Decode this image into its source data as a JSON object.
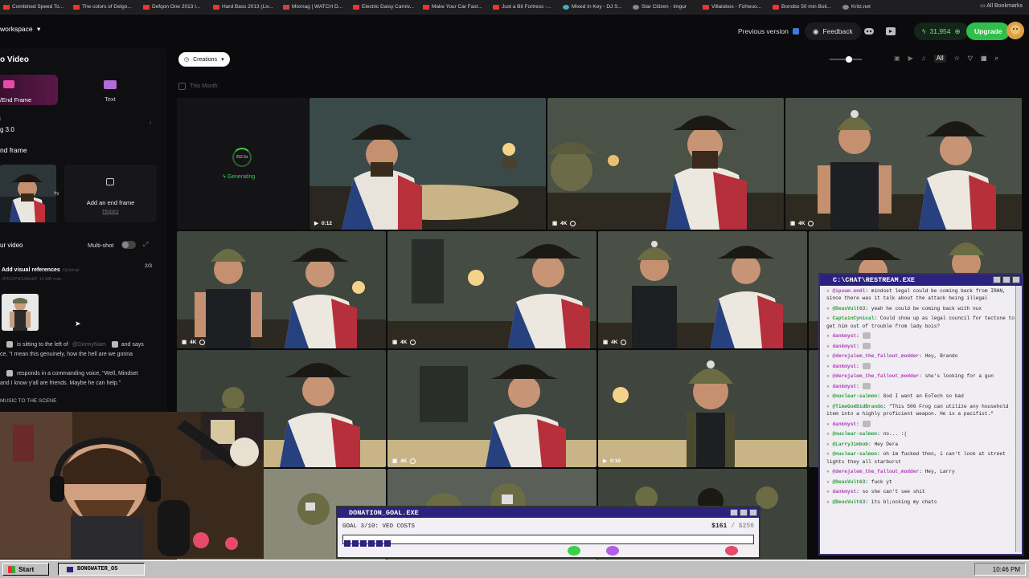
{
  "bookmarks": [
    {
      "label": "Combined Speed To...",
      "icon": "feather-icon"
    },
    {
      "label": "The colors of Delgo...",
      "icon": "youtube-icon"
    },
    {
      "label": "Defqon One 2013 I...",
      "icon": "youtube-icon"
    },
    {
      "label": "Hard Bass 2013 (Liv...",
      "icon": "youtube-icon"
    },
    {
      "label": "Mixmag | WATCH D...",
      "icon": "mixmag-icon"
    },
    {
      "label": "Electric Daisy Carniv...",
      "icon": "youtube-icon"
    },
    {
      "label": "Make Your Car Fast...",
      "icon": "youtube-icon"
    },
    {
      "label": "Just a Bit Fortress -...",
      "icon": "youtube-icon"
    },
    {
      "label": "Mixed In Key - DJ S...",
      "icon": "site-icon"
    },
    {
      "label": "Star Citizen - Imgur",
      "icon": "globe-icon"
    },
    {
      "label": "Villalobos - Fizheuo...",
      "icon": "youtube-icon"
    },
    {
      "label": "Bonobo 50 min Boil...",
      "icon": "youtube-icon"
    },
    {
      "label": "Kritz.net",
      "icon": "globe-icon"
    }
  ],
  "all_bookmarks": "All Bookmarks",
  "topbar": {
    "workspace": "workspace",
    "previous_version": "Previous version",
    "feedback": "Feedback",
    "credits": "31,954",
    "upgrade": "Upgrade"
  },
  "left": {
    "title": "o Video",
    "tab_frames": "/End Frame",
    "tab_text": "Text",
    "model_label": "l",
    "model_value": "g 3.0",
    "end_frame_heading": "nd frame",
    "add_end_frame": "Add an end frame",
    "history": "History",
    "your_video": "ur video",
    "multi_shot": "Multi-shot",
    "visual_refs": "Add visual references",
    "optional": "Optional",
    "refs_count": "2/3",
    "formats": "JPEG/PNG/WebP, 10 MB max",
    "prompt_line1_a": "is sitting to the left of",
    "prompt_line1_mention": "@DonnyNam",
    "prompt_line1_b": "and says",
    "prompt_line2": "ce, \"I mean this genuinely, how the hell are we gonna",
    "prompt_line3": "d",
    "prompt_line4": "responds in a commanding voice, \"Well, Mindset",
    "prompt_line5": "and I know y'all are friends. Maybe he can help.\"",
    "prompt_line6": "MUSIC TO THE SCENE"
  },
  "gallery": {
    "filter": "Creations",
    "section": "This Month",
    "tab_all": "All",
    "generating_time": "252.5s",
    "generating": "Generating",
    "badges": [
      "0:12",
      "4K",
      "4K",
      "4K",
      "4K",
      "4K",
      "4K",
      "0:10"
    ]
  },
  "chat": {
    "title": "C:\\CHAT\\RESTREAM.EXE",
    "lines": [
      {
        "user": "@ipsum.endl",
        "text": "mindset legal could be coming back from IRAN, since there was it talk about the attack being illegal",
        "color": "p"
      },
      {
        "user": "@DeusVult63",
        "text": "yeah he could be coming back with nux",
        "color": "g"
      },
      {
        "user": "CaptainCynical",
        "text": "Could show up as legal council for tectone to get him out of trouble from lady bois?",
        "color": "g"
      },
      {
        "user": "dankmyst",
        "text": "",
        "color": "p"
      },
      {
        "user": "dankmyst",
        "text": "",
        "color": "p"
      },
      {
        "user": "@derejalem_the_fallout_modder",
        "text": "Hey, Brando",
        "color": "p"
      },
      {
        "user": "dankmyst",
        "text": "",
        "color": "p"
      },
      {
        "user": "@derejalem_the_fallout_modder",
        "text": "she's looking for a gun",
        "color": "p"
      },
      {
        "user": "dankmyst",
        "text": "",
        "color": "p"
      },
      {
        "user": "@nuclear-salmon",
        "text": "God I want an EoTech so bad",
        "color": "g"
      },
      {
        "user": "@TimeGodDidBrando",
        "text": "\"This 506 Frog can utilize any household item into a highly proficient weapon. He is a pacifist.\"",
        "color": "g"
      },
      {
        "user": "dankmyst",
        "text": "",
        "color": "p"
      },
      {
        "user": "@nuclear-salmon",
        "text": "no... :(",
        "color": "g"
      },
      {
        "user": "@LarryJimbob",
        "text": "Hey Dera",
        "color": "g"
      },
      {
        "user": "@nuclear-salmon",
        "text": "oh im fucked then, i can't look at street lights they all starburst",
        "color": "g"
      },
      {
        "user": "@derejalem_the_fallout_modder",
        "text": "Hey, Larry",
        "color": "p"
      },
      {
        "user": "@DeusVult63",
        "text": "fuck yt",
        "color": "g"
      },
      {
        "user": "dankmyst",
        "text": "so she can't see shit",
        "color": "p"
      },
      {
        "user": "@DeusVult63",
        "text": "its bl;ocking my chats",
        "color": "g"
      }
    ]
  },
  "donation": {
    "title": "DONATION_GOAL.EXE",
    "goal": "GOAL 3/10: VEO COSTS",
    "current": "$161",
    "separator": "/",
    "target": "$250",
    "progress": 0.644
  },
  "taskbar": {
    "start": "Start",
    "window": "BONGWATER_OS",
    "clock": "10:46 PM"
  }
}
